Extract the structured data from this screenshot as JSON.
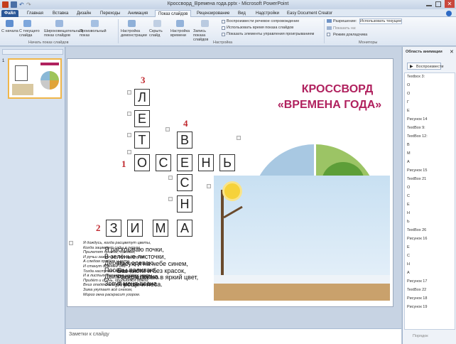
{
  "app": {
    "title": "Кроссворд_Времена года.pptx - Microsoft PowerPoint"
  },
  "tabs": [
    "Файл",
    "Главная",
    "Вставка",
    "Дизайн",
    "Переходы",
    "Анимация",
    "Показ слайдов",
    "Рецензирование",
    "Вид",
    "Надстройки",
    "Easy Document Creator"
  ],
  "ribbon": {
    "btn1": "С начала",
    "btn2": "С текущего слайда",
    "btn3": "Широковещательный показ слайдов",
    "btn4": "Произвольный показ",
    "group1": "Начать показ слайдов",
    "btn5": "Настройка демонстрации",
    "btn6": "Скрыть слайд",
    "btn7": "Настройка времени",
    "btn8": "Запись показа слайдов",
    "chk1": "Воспроизвести речевое сопровождение",
    "chk2": "Использовать время показа слайдов",
    "chk3": "Показать элементы управления проигрыванием",
    "group2": "Настройка",
    "res_label": "Разрешение:",
    "res_value": "Использовать текущее",
    "monitor_label": "Показать на:",
    "presenter": "Режим докладчика",
    "group3": "Мониторы"
  },
  "thumb": {
    "number": "1"
  },
  "slide": {
    "title_line1": "КРОССВОРД",
    "title_line2": "«ВРЕМЕНА ГОДА»",
    "clue_numbers": {
      "n1": "1",
      "n2": "2",
      "n3": "3",
      "n4": "4"
    },
    "letters_leto": [
      "Л",
      "Е",
      "Т",
      "О"
    ],
    "letters_osen": [
      "О",
      "С",
      "Е",
      "Н",
      "Ь"
    ],
    "letters_vesna": [
      "В",
      "Е",
      "С",
      "Н",
      "А"
    ],
    "letters_zima": [
      "З",
      "И",
      "М",
      "А"
    ],
    "poem_small": [
      "Я дождусь, когда расцветут цветы,",
      "Когда зацветут сады в округе,",
      "Прилетят дрозды, соловьи,",
      "И ручьи зажурчат друг за другом.",
      "А следом придёт и лето,",
      "И станут длиннее дни.",
      "Тогда наступит пора рассвета,",
      "И в листьях деревьев найдём цветы.",
      "Придёт и осень, прольются дожди,",
      "Вниз опадёт вся листва с деревьев.",
      "Зима укутает всё снегом,",
      "Мороз окна раскрасит узором."
    ],
    "poem_large": [
      "Я раскрываю почки,",
      "В зелёные листочки,",
      "Деревья одеваю,",
      "Посевы поливаю,",
      "Движением полна,",
      "Зовут меня весна."
    ],
    "poem_overlap": [
      "Рисую я на небе синем,",
      "Без кисти и без красок,",
      "Раскрашиваю в яркий цвет,",
      "Я рощи и леса."
    ]
  },
  "notes": {
    "placeholder": "Заметки к слайду"
  },
  "pane": {
    "title": "Область анимации",
    "play": "Воспроизвести",
    "items": [
      "Textbox 3:",
      "О",
      "О",
      "Г",
      "Е",
      "Рисунок 14",
      "TextBox 9:",
      "TextBox 12:",
      "В",
      "М",
      "А",
      "Рисунок 15",
      "TextBox 21",
      "О",
      "С",
      "Е",
      "Н",
      "Ь",
      "TextBox 26",
      "Рисунок 16",
      "Е",
      "С",
      "Н",
      "А",
      "Рисунок 17",
      "TextBox 22",
      "Рисунок 18",
      "Рисунок 19"
    ],
    "reorder": "Порядок"
  },
  "colors": {
    "title": "#b0215e",
    "numbers": "#c0282e",
    "file_tab": "#2b5797"
  }
}
